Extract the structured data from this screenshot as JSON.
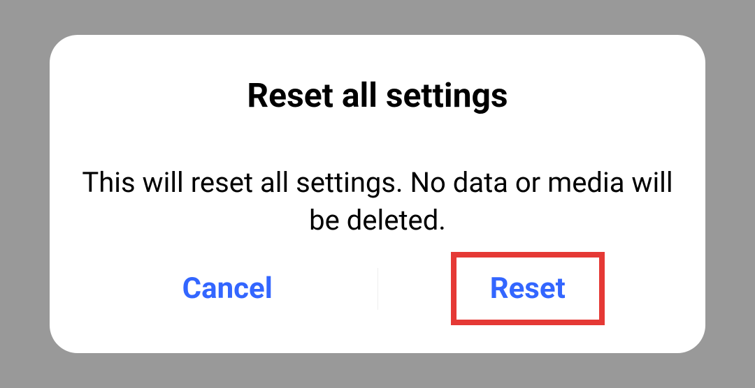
{
  "dialog": {
    "title": "Reset all settings",
    "message": "This will reset all settings. No data or media will be deleted.",
    "cancel_label": "Cancel",
    "confirm_label": "Reset"
  }
}
